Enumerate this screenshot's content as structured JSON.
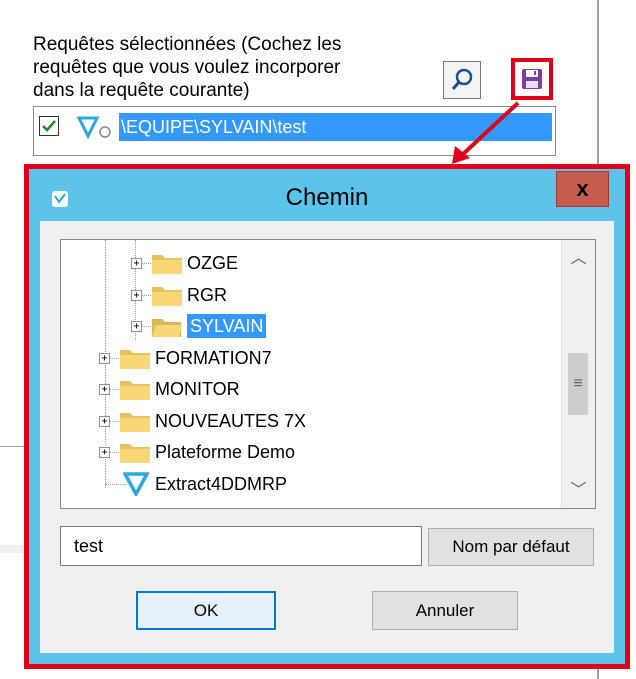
{
  "background": {
    "instructions": "Requêtes sélectionnées (Cochez les\nrequêtes que vous voulez incorporer\ndans la requête courante)",
    "search_icon": "magnifier-icon",
    "save_icon": "floppy-disk-icon",
    "selected_query": {
      "checked": true,
      "label": "\\EQUIPE\\SYLVAIN\\test"
    }
  },
  "dialog": {
    "title": "Chemin",
    "close_label": "x",
    "tree": [
      {
        "label": "OZGE",
        "level": 2,
        "expandable": true,
        "selected": false,
        "icon": "folder-icon"
      },
      {
        "label": "RGR",
        "level": 2,
        "expandable": true,
        "selected": false,
        "icon": "folder-icon"
      },
      {
        "label": "SYLVAIN",
        "level": 2,
        "expandable": true,
        "selected": true,
        "icon": "folder-open-icon"
      },
      {
        "label": "FORMATION7",
        "level": 1,
        "expandable": true,
        "selected": false,
        "icon": "folder-icon"
      },
      {
        "label": "MONITOR",
        "level": 1,
        "expandable": true,
        "selected": false,
        "icon": "folder-icon"
      },
      {
        "label": "NOUVEAUTES 7X",
        "level": 1,
        "expandable": true,
        "selected": false,
        "icon": "folder-icon"
      },
      {
        "label": "Plateforme Demo",
        "level": 1,
        "expandable": true,
        "selected": false,
        "icon": "folder-icon"
      },
      {
        "label": "Extract4DDMRP",
        "level": 1,
        "expandable": false,
        "selected": false,
        "icon": "query-v-icon"
      }
    ],
    "name_value": "test",
    "default_name_label": "Nom par défaut",
    "ok_label": "OK",
    "cancel_label": "Annuler"
  },
  "colors": {
    "highlight_red": "#e0001a",
    "dialog_blue": "#5cc3ea",
    "selection_blue": "#3399ff",
    "folder_yellow": "#f8d775",
    "close_red": "#c85b4f"
  }
}
